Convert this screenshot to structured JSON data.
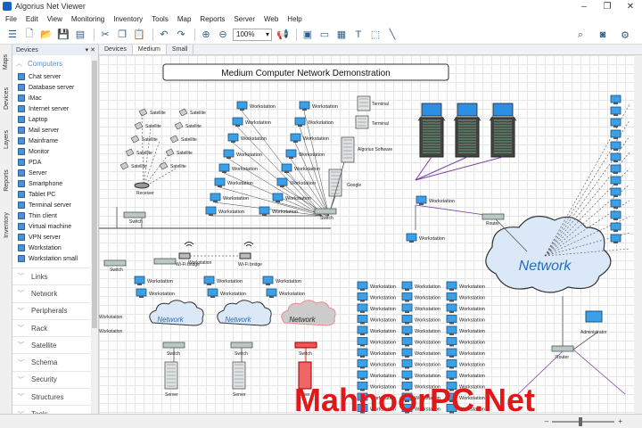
{
  "window": {
    "title": "Algorius Net Viewer",
    "controls": [
      "–",
      "❐",
      "✕"
    ]
  },
  "menu": [
    "File",
    "Edit",
    "View",
    "Monitoring",
    "Inventory",
    "Tools",
    "Map",
    "Reports",
    "Server",
    "Web",
    "Help"
  ],
  "toolbar": {
    "zoom": "100%"
  },
  "left_tabs": [
    "Maps",
    "Devices",
    "Layers",
    "Reports",
    "Inventory"
  ],
  "panel": {
    "title": "Devices",
    "controls": "▾ ✕",
    "category": "Computers",
    "items": [
      "Chat server",
      "Database server",
      "iMac",
      "Internet server",
      "Laptop",
      "Mail server",
      "Mainframe",
      "Monitor",
      "PDA",
      "Server",
      "Smartphone",
      "Tablet PC",
      "Terminal server",
      "Thin client",
      "Virtual machine",
      "VPN server",
      "Workstation",
      "Workstation small"
    ],
    "collapsed": [
      "Links",
      "Network",
      "Peripherals",
      "Rack",
      "Satellite",
      "Schema",
      "Security",
      "Structures",
      "Tools"
    ]
  },
  "tabs": [
    "Devices",
    "Medium",
    "Small"
  ],
  "diagram": {
    "title": "Medium Computer Network Demonstration",
    "satellite": "Satellite",
    "receiver": "Receiver",
    "switch": "Switch",
    "workstation": "Workstation",
    "terminal": "Terminal",
    "algorius": "Algorius Software",
    "google": "Google",
    "router": "Router",
    "wifi": "Wi-Fi bridge",
    "network": "Network",
    "server": "Server",
    "administrator": "Administrator"
  },
  "watermark": "MahnoorPC.Net",
  "status": {
    "zoom_out": "–",
    "zoom_in": "+"
  },
  "colors": {
    "accent": "#1f6fbf",
    "cloud_fill": "#dbe8f7",
    "cloud_red": "#e88",
    "link_purple": "#7a3fa0",
    "watermark": "#e01818"
  }
}
